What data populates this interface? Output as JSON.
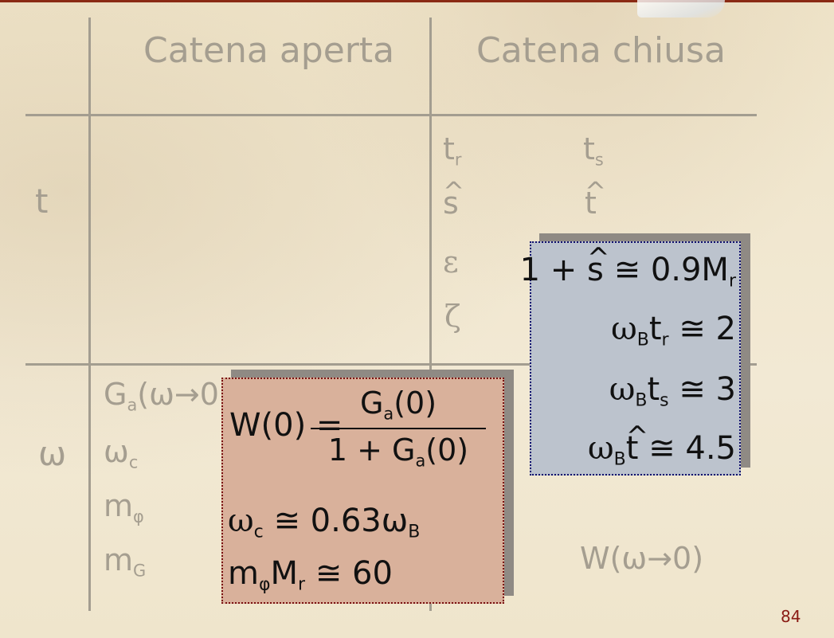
{
  "header": {
    "col_open": "Catena aperta",
    "col_closed": "Catena chiusa"
  },
  "rows": {
    "time_label": "t",
    "freq_label": "ω"
  },
  "closed_time": {
    "tr": "t",
    "tr_sub": "r",
    "ts": "t",
    "ts_sub": "s",
    "s_hat": "s",
    "t_hat": "t",
    "epsilon": "ε",
    "zeta": "ζ"
  },
  "open_freq": {
    "ga_left": "G",
    "ga_sub": "a",
    "ga_rest": "(ω→0",
    "wc": "ω",
    "wc_sub": "c",
    "mphi": "m",
    "mphi_sub": "φ",
    "mg": "m",
    "mg_sub": "G"
  },
  "closed_freq": {
    "w_limit": "W(ω→0)"
  },
  "red_box": {
    "lhs": "W(0) =",
    "num_g": "G",
    "num_sub": "a",
    "num_rest": "(0)",
    "den_pre": "1 + G",
    "den_sub": "a",
    "den_rest": "(0)",
    "line2_pre": "ω",
    "line2_sub": "c",
    "line2_mid": " ≅ 0.63ω",
    "line2_sub2": "B",
    "line3_m": "m",
    "line3_sub": "φ",
    "line3_M": "M",
    "line3_sub2": "r",
    "line3_rest": " ≅ 60"
  },
  "blue_box": {
    "line1_pre": "1 + ",
    "line1_s": "s",
    "line1_rest": " ≅ 0.9M",
    "line1_sub": "r",
    "line2_w": "ω",
    "line2_wsub": "B",
    "line2_t": "t",
    "line2_tsub": "r",
    "line2_rest": " ≅ 2",
    "line3_w": "ω",
    "line3_wsub": "B",
    "line3_t": "t",
    "line3_tsub": "s",
    "line3_rest": " ≅ 3",
    "line4_w": "ω",
    "line4_wsub": "B",
    "line4_t": "t",
    "line4_rest": " ≅ 4.5"
  },
  "page_number": "84"
}
